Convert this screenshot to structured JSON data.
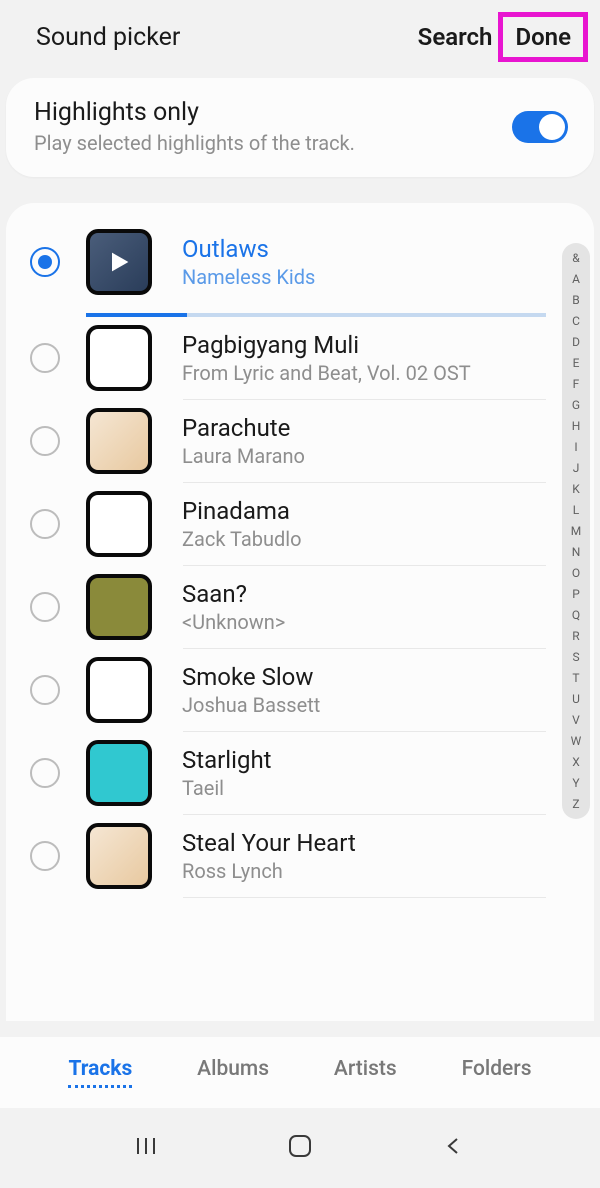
{
  "header": {
    "title": "Sound picker",
    "search_label": "Search",
    "done_label": "Done"
  },
  "highlights": {
    "title": "Highlights only",
    "subtitle": "Play selected highlights of the track.",
    "enabled": true
  },
  "tracks": [
    {
      "title": "Outlaws",
      "artist": "Nameless Kids",
      "selected": true,
      "thumb": "play"
    },
    {
      "title": "Pagbigyang Muli",
      "artist": "From Lyric and Beat, Vol. 02 OST",
      "selected": false,
      "thumb": "blank"
    },
    {
      "title": "Parachute",
      "artist": "Laura Marano",
      "selected": false,
      "thumb": "photo"
    },
    {
      "title": "Pinadama",
      "artist": "Zack Tabudlo",
      "selected": false,
      "thumb": "blank"
    },
    {
      "title": "Saan?",
      "artist": "<Unknown>",
      "selected": false,
      "thumb": "olive"
    },
    {
      "title": "Smoke Slow",
      "artist": "Joshua Bassett",
      "selected": false,
      "thumb": "blank"
    },
    {
      "title": "Starlight",
      "artist": "Taeil",
      "selected": false,
      "thumb": "teal"
    },
    {
      "title": "Steal Your Heart",
      "artist": "Ross Lynch",
      "selected": false,
      "thumb": "photo"
    }
  ],
  "alpha_index": [
    "&",
    "A",
    "B",
    "C",
    "D",
    "E",
    "F",
    "G",
    "H",
    "I",
    "J",
    "K",
    "L",
    "M",
    "N",
    "O",
    "P",
    "Q",
    "R",
    "S",
    "T",
    "U",
    "V",
    "W",
    "X",
    "Y",
    "Z"
  ],
  "tabs": [
    {
      "label": "Tracks",
      "active": true
    },
    {
      "label": "Albums",
      "active": false
    },
    {
      "label": "Artists",
      "active": false
    },
    {
      "label": "Folders",
      "active": false
    }
  ]
}
